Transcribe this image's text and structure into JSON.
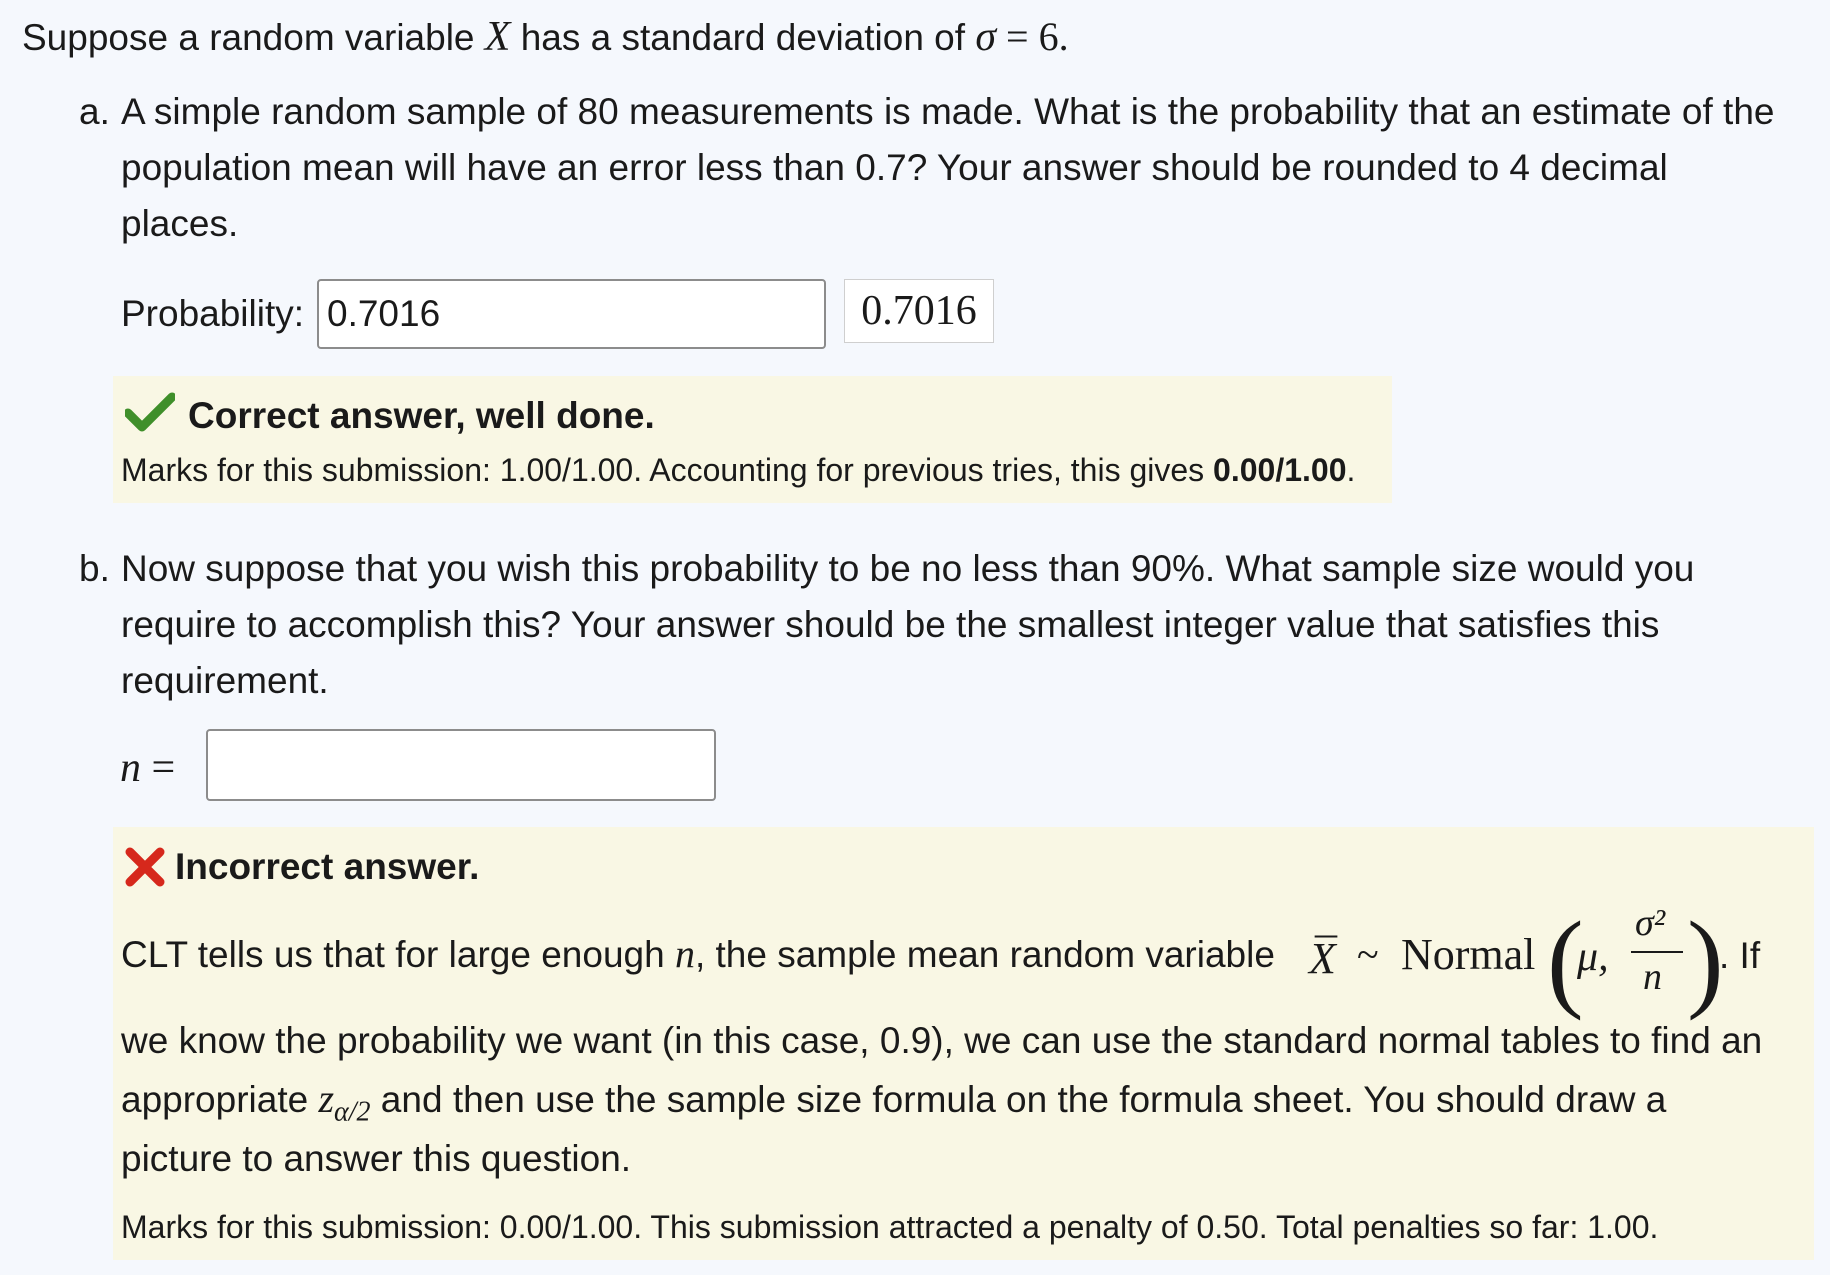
{
  "intro": {
    "prefix": "Suppose a random variable ",
    "var": "X",
    "middle": " has a standard deviation of ",
    "sigma_expr": "σ = 6."
  },
  "part_a": {
    "marker": "a.",
    "lines": [
      "A simple random sample of 80 measurements is made. What is the probability that an estimate of the",
      "population mean will have an error less than 0.7? Your answer should be rounded to 4 decimal",
      "places."
    ],
    "input_label": "Probability:",
    "input_value": "0.7016",
    "preview_value": "0.7016",
    "feedback": {
      "status_icon": "check-icon",
      "status_color": "#3f8f2a",
      "status": "Correct answer, well done.",
      "marks_prefix": "Marks for this submission: 1.00/1.00. Accounting for previous tries, this gives ",
      "marks_total": "0.00/1.00",
      "marks_suffix": "."
    }
  },
  "part_b": {
    "marker": "b.",
    "lines": [
      "Now suppose that you wish this probability to be no less than 90%. What sample size would you",
      "require to accomplish this? Your answer should be the smallest integer value that satisfies this",
      "requirement."
    ],
    "input_label": "n =",
    "input_value": "",
    "feedback": {
      "status_icon": "cross-icon",
      "status_color": "#d6281c",
      "status": "Incorrect answer.",
      "clt_prefix": "CLT tells us that for large enough ",
      "clt_n": "n",
      "clt_middle": ", the sample mean random variable ",
      "clt_xbar": "X",
      "clt_tilde": "~",
      "clt_normal": "Normal",
      "clt_mu": "μ,",
      "clt_num": "σ²",
      "clt_den": "n",
      "clt_suffix": ". If",
      "line2": "we know the probability we want (in this case, 0.9), we can use the standard normal tables to find an",
      "line3_prefix": "appropriate ",
      "line3_z": "z",
      "line3_sub": "α/2",
      "line3_suffix": " and then use the sample size formula on the formula sheet.  You should draw a",
      "line4": "picture to answer this question.",
      "marks": "Marks for this submission: 0.00/1.00. This submission attracted a penalty of 0.50. Total penalties so far: 1.00."
    }
  }
}
